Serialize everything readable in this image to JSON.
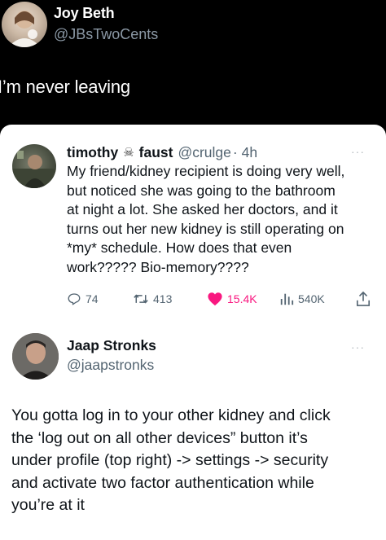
{
  "outer_tweet": {
    "author_name": "Joy Beth",
    "author_handle": "@JBsTwoCents",
    "text": "I’m never leaving"
  },
  "quoted_tweet": {
    "author_first": "timothy",
    "author_emoji": "skull-icon",
    "author_last": "faust",
    "author_handle": "@crulge",
    "time": "· 4h",
    "more": "···",
    "body_lines": [
      "My friend/kidney recipient is doing very well,",
      "but noticed she was going to the bathroom",
      "at night a lot. She asked her doctors, and it",
      "turns out her new kidney is still operating on",
      "*my* schedule. How does that even",
      "work????? Bio-memory????"
    ],
    "actions": {
      "replies": "74",
      "retweets": "413",
      "likes": "15.4K",
      "views": "540K"
    },
    "colors": {
      "like": "#f91880",
      "secondary": "#536471"
    }
  },
  "reply_tweet": {
    "author_name": "Jaap Stronks",
    "author_handle": "@jaapstronks",
    "more": "···",
    "body_lines": [
      "You gotta log in to your other kidney and click",
      "the ‘log out on all other devices” button it’s",
      "under profile (top right) -> settings -> security",
      "and activate two factor authentication while",
      "you’re at it"
    ]
  }
}
